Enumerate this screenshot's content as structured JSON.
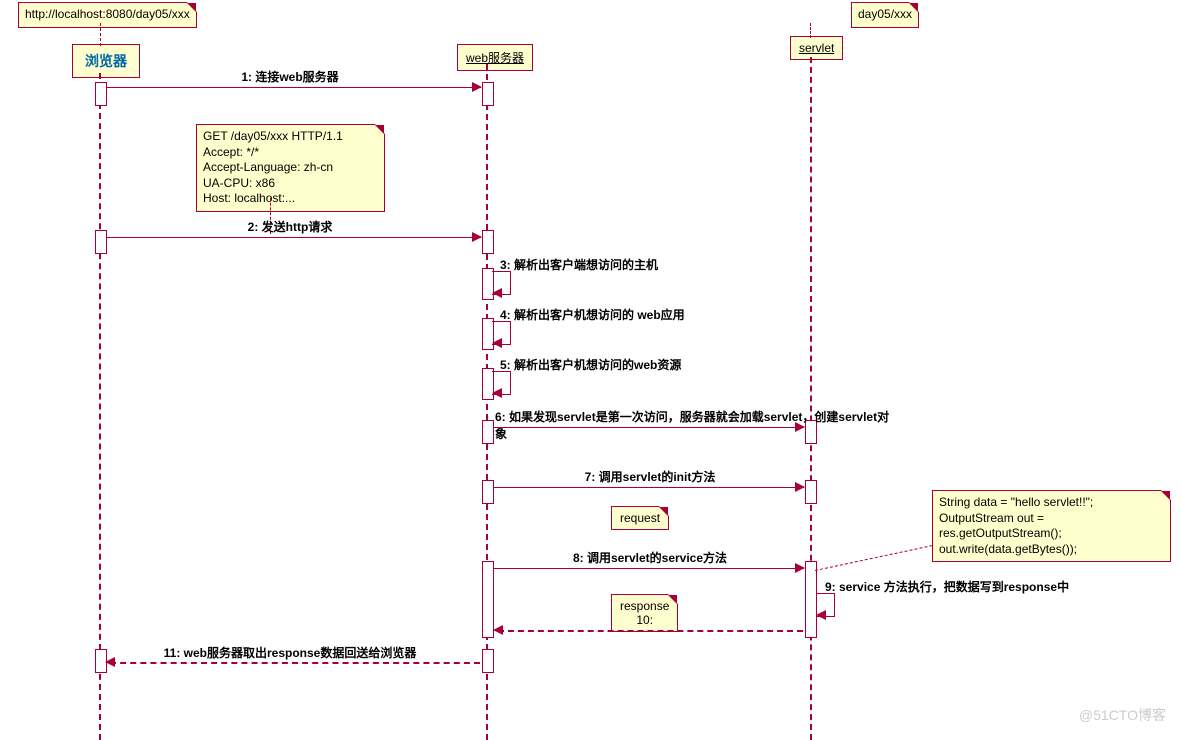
{
  "notes": {
    "url": "http://localhost:8080/day05/xxx",
    "servlet_path": "day05/xxx",
    "http_request": "GET /day05/xxx  HTTP/1.1\nAccept: */*\nAccept-Language: zh-cn\nUA-CPU: x86\nHost: localhost:...",
    "code": "String data = \"hello servlet!!\";\nOutputStream out = res.getOutputStream();\nout.write(data.getBytes());"
  },
  "actors": {
    "browser": "浏览器",
    "webserver": "web服务器",
    "servlet": "servlet"
  },
  "messages": {
    "m1": "1: 连接web服务器",
    "m2": "2: 发送http请求",
    "m3": "3: 解析出客户端想访问的主机",
    "m4": "4: 解析出客户机想访问的 web应用",
    "m5": "5: 解析出客户机想访问的web资源",
    "m6": "6: 如果发现servlet是第一次访问，服务器就会加载servlet，创建servlet对象",
    "m7": "7: 调用servlet的init方法",
    "m8": "8: 调用servlet的service方法",
    "m9": "9: service 方法执行，把数据写到response中",
    "m10": "10:",
    "m11": "11: web服务器取出response数据回送给浏览器",
    "request": "request",
    "response": "response"
  },
  "watermark": "@51CTO博客"
}
